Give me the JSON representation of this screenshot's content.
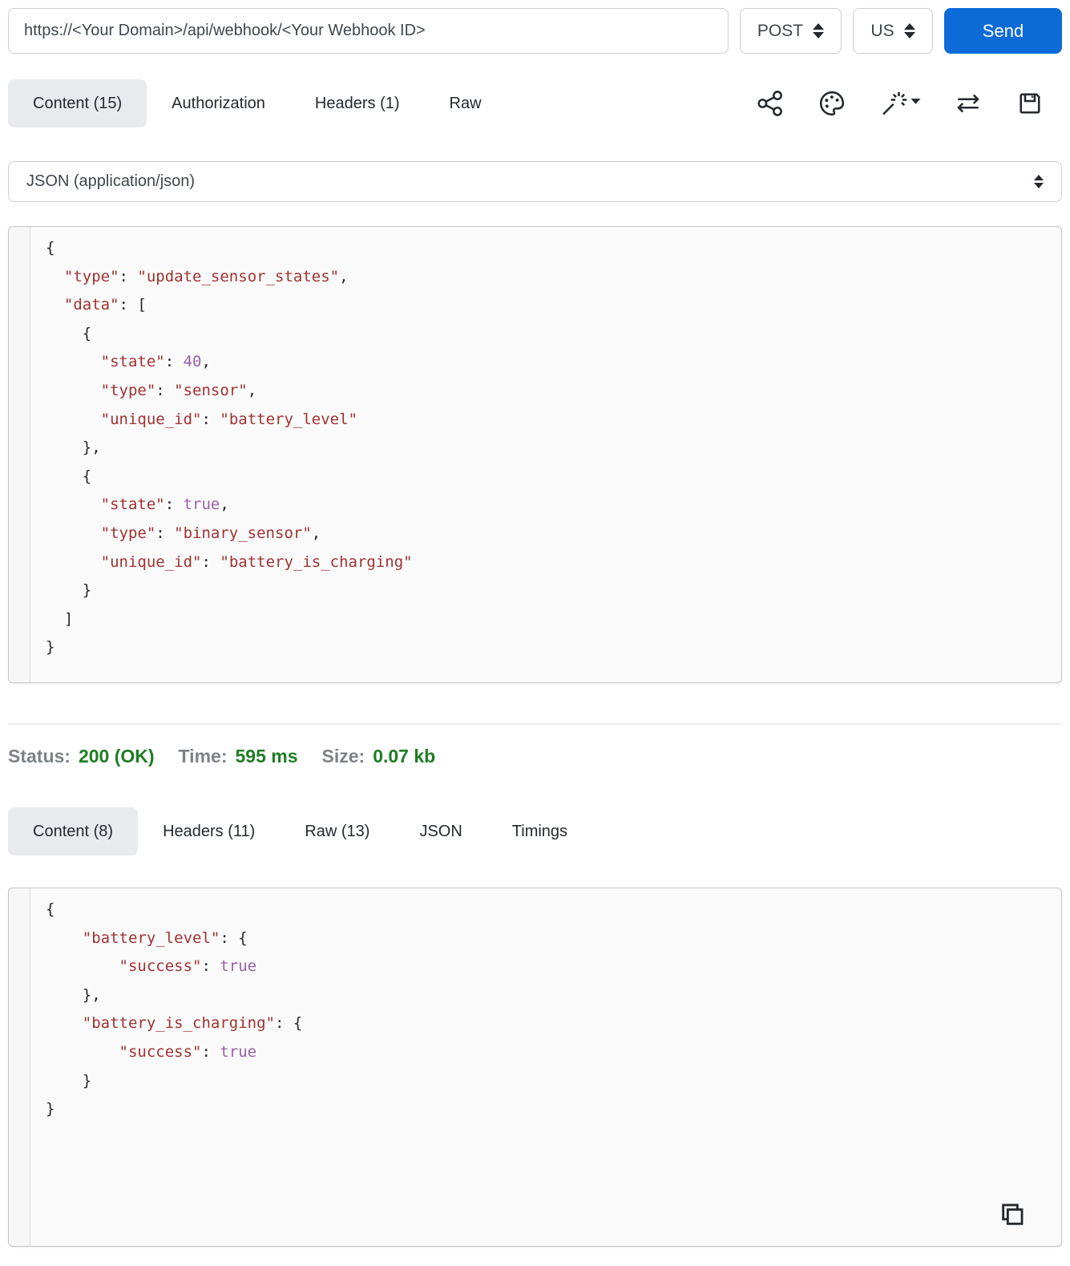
{
  "request_bar": {
    "url": "https://<Your Domain>/api/webhook/<Your Webhook ID>",
    "method": "POST",
    "region": "US",
    "send_label": "Send"
  },
  "request_tabs": [
    {
      "label": "Content (15)",
      "active": true
    },
    {
      "label": "Authorization",
      "active": false
    },
    {
      "label": "Headers (1)",
      "active": false
    },
    {
      "label": "Raw",
      "active": false
    }
  ],
  "toolbar": {
    "icons": [
      "share-icon",
      "palette-icon",
      "magic-wand-dropdown-icon",
      "swap-arrows-icon",
      "save-icon"
    ]
  },
  "body_type": {
    "selected": "JSON (application/json)"
  },
  "request_body": {
    "lines": [
      [
        {
          "t": "p",
          "v": "{"
        }
      ],
      [
        {
          "t": "p",
          "v": "  "
        },
        {
          "t": "s",
          "v": "\"type\""
        },
        {
          "t": "p",
          "v": ": "
        },
        {
          "t": "s",
          "v": "\"update_sensor_states\""
        },
        {
          "t": "p",
          "v": ","
        }
      ],
      [
        {
          "t": "p",
          "v": "  "
        },
        {
          "t": "s",
          "v": "\"data\""
        },
        {
          "t": "p",
          "v": ": ["
        }
      ],
      [
        {
          "t": "p",
          "v": "    {"
        }
      ],
      [
        {
          "t": "p",
          "v": "      "
        },
        {
          "t": "s",
          "v": "\"state\""
        },
        {
          "t": "p",
          "v": ": "
        },
        {
          "t": "n",
          "v": "40"
        },
        {
          "t": "p",
          "v": ","
        }
      ],
      [
        {
          "t": "p",
          "v": "      "
        },
        {
          "t": "s",
          "v": "\"type\""
        },
        {
          "t": "p",
          "v": ": "
        },
        {
          "t": "s",
          "v": "\"sensor\""
        },
        {
          "t": "p",
          "v": ","
        }
      ],
      [
        {
          "t": "p",
          "v": "      "
        },
        {
          "t": "s",
          "v": "\"unique_id\""
        },
        {
          "t": "p",
          "v": ": "
        },
        {
          "t": "s",
          "v": "\"battery_level\""
        }
      ],
      [
        {
          "t": "p",
          "v": "    },"
        }
      ],
      [
        {
          "t": "p",
          "v": "    {"
        }
      ],
      [
        {
          "t": "p",
          "v": "      "
        },
        {
          "t": "s",
          "v": "\"state\""
        },
        {
          "t": "p",
          "v": ": "
        },
        {
          "t": "n",
          "v": "true"
        },
        {
          "t": "p",
          "v": ","
        }
      ],
      [
        {
          "t": "p",
          "v": "      "
        },
        {
          "t": "s",
          "v": "\"type\""
        },
        {
          "t": "p",
          "v": ": "
        },
        {
          "t": "s",
          "v": "\"binary_sensor\""
        },
        {
          "t": "p",
          "v": ","
        }
      ],
      [
        {
          "t": "p",
          "v": "      "
        },
        {
          "t": "s",
          "v": "\"unique_id\""
        },
        {
          "t": "p",
          "v": ": "
        },
        {
          "t": "s",
          "v": "\"battery_is_charging\""
        }
      ],
      [
        {
          "t": "p",
          "v": "    }"
        }
      ],
      [
        {
          "t": "p",
          "v": "  ]"
        }
      ],
      [
        {
          "t": "p",
          "v": "}"
        }
      ]
    ]
  },
  "response_status": {
    "status_label": "Status:",
    "status_value": "200 (OK)",
    "time_label": "Time:",
    "time_value": "595 ms",
    "size_label": "Size:",
    "size_value": "0.07 kb"
  },
  "response_tabs": [
    {
      "label": "Content (8)",
      "active": true
    },
    {
      "label": "Headers (11)",
      "active": false
    },
    {
      "label": "Raw (13)",
      "active": false
    },
    {
      "label": "JSON",
      "active": false
    },
    {
      "label": "Timings",
      "active": false
    }
  ],
  "response_body": {
    "lines": [
      [
        {
          "t": "p",
          "v": "{"
        }
      ],
      [
        {
          "t": "p",
          "v": "    "
        },
        {
          "t": "s",
          "v": "\"battery_level\""
        },
        {
          "t": "p",
          "v": ": {"
        }
      ],
      [
        {
          "t": "p",
          "v": "        "
        },
        {
          "t": "s",
          "v": "\"success\""
        },
        {
          "t": "p",
          "v": ": "
        },
        {
          "t": "n",
          "v": "true"
        }
      ],
      [
        {
          "t": "p",
          "v": "    },"
        }
      ],
      [
        {
          "t": "p",
          "v": "    "
        },
        {
          "t": "s",
          "v": "\"battery_is_charging\""
        },
        {
          "t": "p",
          "v": ": {"
        }
      ],
      [
        {
          "t": "p",
          "v": "        "
        },
        {
          "t": "s",
          "v": "\"success\""
        },
        {
          "t": "p",
          "v": ": "
        },
        {
          "t": "n",
          "v": "true"
        }
      ],
      [
        {
          "t": "p",
          "v": "    }"
        }
      ],
      [
        {
          "t": "p",
          "v": "}"
        }
      ]
    ]
  },
  "colors": {
    "accent_blue": "#0d6bd8",
    "status_green": "#1e7d23",
    "label_gray": "#7e8287",
    "string_red": "#a03232",
    "literal_purple": "#9b5faa",
    "punct": "#24292e",
    "tab_active_bg": "#e9eaed"
  }
}
